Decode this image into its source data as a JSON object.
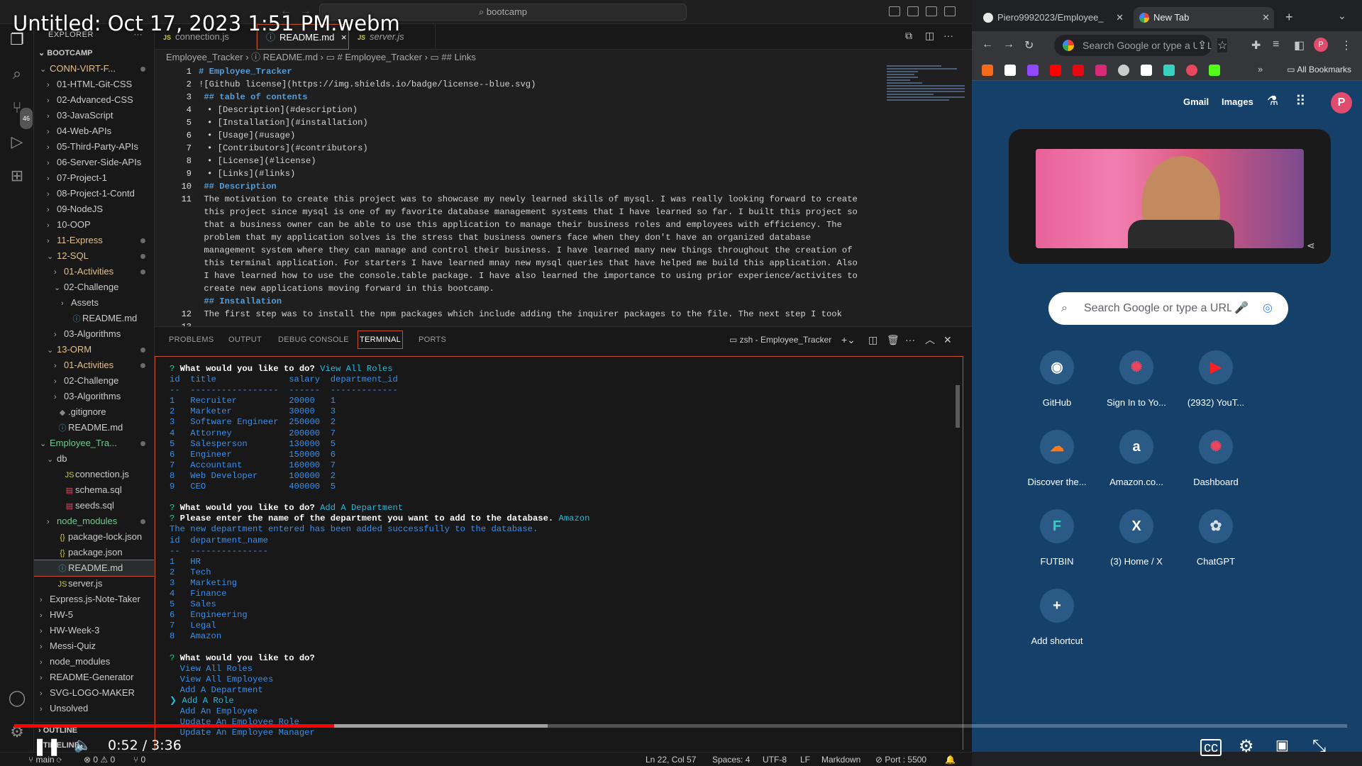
{
  "video": {
    "title": "Untitled: Oct 17, 2023 1:51 PM.webm",
    "time": "0:52 / 3:36",
    "progress": 0.24,
    "buffered": 0.4
  },
  "vscode": {
    "title_search": "bootcamp",
    "explorer_label": "EXPLORER",
    "root": "BOOTCAMP",
    "scm_badge": "46",
    "tree": [
      {
        "indent": 0,
        "chev": "⌄",
        "label": "CONN-VIRT-F...",
        "cls": "git-yellow",
        "dot": true
      },
      {
        "indent": 1,
        "chev": "›",
        "label": "01-HTML-Git-CSS"
      },
      {
        "indent": 1,
        "chev": "›",
        "label": "02-Advanced-CSS"
      },
      {
        "indent": 1,
        "chev": "›",
        "label": "03-JavaScript"
      },
      {
        "indent": 1,
        "chev": "›",
        "label": "04-Web-APIs"
      },
      {
        "indent": 1,
        "chev": "›",
        "label": "05-Third-Party-APIs"
      },
      {
        "indent": 1,
        "chev": "›",
        "label": "06-Server-Side-APIs"
      },
      {
        "indent": 1,
        "chev": "›",
        "label": "07-Project-1"
      },
      {
        "indent": 1,
        "chev": "›",
        "label": "08-Project-1-Contd"
      },
      {
        "indent": 1,
        "chev": "›",
        "label": "09-NodeJS"
      },
      {
        "indent": 1,
        "chev": "›",
        "label": "10-OOP"
      },
      {
        "indent": 1,
        "chev": "›",
        "label": "11-Express",
        "cls": "git-yellow",
        "dot": true
      },
      {
        "indent": 1,
        "chev": "⌄",
        "label": "12-SQL",
        "cls": "git-yellow",
        "dot": true
      },
      {
        "indent": 2,
        "chev": "›",
        "label": "01-Activities",
        "cls": "git-yellow",
        "dot": true
      },
      {
        "indent": 2,
        "chev": "⌄",
        "label": "02-Challenge"
      },
      {
        "indent": 3,
        "chev": "›",
        "label": "Assets"
      },
      {
        "indent": 3,
        "chev": "",
        "icon": "ⓘ",
        "label": "README.md"
      },
      {
        "indent": 2,
        "chev": "›",
        "label": "03-Algorithms"
      },
      {
        "indent": 1,
        "chev": "⌄",
        "label": "13-ORM",
        "cls": "git-yellow",
        "dot": true
      },
      {
        "indent": 2,
        "chev": "›",
        "label": "01-Activities",
        "cls": "git-yellow",
        "dot": true
      },
      {
        "indent": 2,
        "chev": "›",
        "label": "02-Challenge"
      },
      {
        "indent": 2,
        "chev": "›",
        "label": "03-Algorithms"
      },
      {
        "indent": 1,
        "chev": "",
        "icon": "◆",
        "label": ".gitignore"
      },
      {
        "indent": 1,
        "chev": "",
        "icon": "ⓘ",
        "label": "README.md"
      },
      {
        "indent": 0,
        "chev": "⌄",
        "label": "Employee_Tra...",
        "cls": "git-green",
        "dot": true
      },
      {
        "indent": 1,
        "chev": "⌄",
        "label": "db"
      },
      {
        "indent": 2,
        "chev": "",
        "icon": "JS",
        "label": "connection.js"
      },
      {
        "indent": 2,
        "chev": "",
        "icon": "▤",
        "label": "schema.sql"
      },
      {
        "indent": 2,
        "chev": "",
        "icon": "▤",
        "label": "seeds.sql"
      },
      {
        "indent": 1,
        "chev": "›",
        "label": "node_modules",
        "cls": "git-green",
        "dot": true
      },
      {
        "indent": 1,
        "chev": "",
        "icon": "{}",
        "label": "package-lock.json"
      },
      {
        "indent": 1,
        "chev": "",
        "icon": "{}",
        "label": "package.json"
      },
      {
        "indent": 1,
        "chev": "",
        "icon": "ⓘ",
        "label": "README.md",
        "sel": true
      },
      {
        "indent": 1,
        "chev": "",
        "icon": "JS",
        "label": "server.js"
      },
      {
        "indent": 0,
        "chev": "›",
        "label": "Express.js-Note-Taker"
      },
      {
        "indent": 0,
        "chev": "›",
        "label": "HW-5"
      },
      {
        "indent": 0,
        "chev": "›",
        "label": "HW-Week-3"
      },
      {
        "indent": 0,
        "chev": "›",
        "label": "Messi-Quiz"
      },
      {
        "indent": 0,
        "chev": "›",
        "label": "node_modules"
      },
      {
        "indent": 0,
        "chev": "›",
        "label": "README-Generator"
      },
      {
        "indent": 0,
        "chev": "›",
        "label": "SVG-LOGO-MAKER"
      },
      {
        "indent": 0,
        "chev": "›",
        "label": "Unsolved"
      }
    ],
    "outline_label": "OUTLINE",
    "timeline_label": "TIMELINE",
    "tabs": {
      "connection": "connection.js",
      "readme": "README.md",
      "server": "server.js"
    },
    "breadcrumb": "Employee_Tracker  ›  ⓘ README.md  ›  ▭ # Employee_Tracker  ›  ▭ ## Links",
    "line_numbers": [
      "1",
      "2",
      "3",
      "4",
      "5",
      "6",
      "7",
      "8",
      "9",
      "10",
      "11",
      "",
      "",
      "",
      "",
      "",
      "",
      "",
      "",
      "12",
      "13"
    ],
    "code": [
      {
        "cls": "h",
        "text": "# Employee_Tracker"
      },
      {
        "cls": "",
        "text": "![Github license](https://img.shields.io/badge/license--blue.svg)"
      },
      {
        "cls": "h",
        "text": " ## table of contents"
      },
      {
        "cls": "list",
        "text": "• [Description](#description)"
      },
      {
        "cls": "list",
        "text": "• [Installation](#installation)"
      },
      {
        "cls": "list",
        "text": "• [Usage](#usage)"
      },
      {
        "cls": "list",
        "text": "• [Contributors](#contributors)"
      },
      {
        "cls": "list",
        "text": "• [License](#license)"
      },
      {
        "cls": "list",
        "text": "• [Links](#links)"
      },
      {
        "cls": "h",
        "text": " ## Description"
      },
      {
        "cls": "",
        "text": " The motivation to create this project was to showcase my newly learned skills of mysql. I was really looking forward to create"
      },
      {
        "cls": "",
        "text": " this project since mysql is one of my favorite database management systems that I have learned so far. I built this project so"
      },
      {
        "cls": "",
        "text": " that a business owner can be able to use this application to manage their business roles and employees with efficiency. The"
      },
      {
        "cls": "",
        "text": " problem that my application solves is the stress that business owners face when they don't have an organized database"
      },
      {
        "cls": "",
        "text": " management system where they can manage and control their business. I have learned many new things throughout the creation of"
      },
      {
        "cls": "",
        "text": " this terminal application. For starters I have learned mnay new mysql queries that have helped me build this application. Also"
      },
      {
        "cls": "",
        "text": " I have learned how to use the console.table package. I have also learned the importance to using prior experience/activites to"
      },
      {
        "cls": "",
        "text": " create new applications moving forward in this bootcamp."
      },
      {
        "cls": "h",
        "text": " ## Installation"
      },
      {
        "cls": "",
        "text": " The first step was to install the npm packages which include adding the inquirer packages to the file. The next step I took"
      }
    ],
    "panel_tabs": {
      "problems": "PROBLEMS",
      "output": "OUTPUT",
      "debug": "DEBUG CONSOLE",
      "terminal": "TERMINAL",
      "ports": "PORTS"
    },
    "terminal_name": "zsh - Employee_Tracker",
    "terminal": [
      {
        "type": "q",
        "prompt": "? ",
        "question": "What would you like to do?",
        "answer": " View All Roles"
      },
      {
        "type": "t",
        "text": "id  title              salary  department_id"
      },
      {
        "type": "t",
        "text": "--  -----------------  ------  -------------"
      },
      {
        "type": "t",
        "text": "1   Recruiter          20000   1"
      },
      {
        "type": "t",
        "text": "2   Marketer           30000   3"
      },
      {
        "type": "t",
        "text": "3   Software Engineer  250000  2"
      },
      {
        "type": "t",
        "text": "4   Attorney           200000  7"
      },
      {
        "type": "t",
        "text": "5   Salesperson        130000  5"
      },
      {
        "type": "t",
        "text": "6   Engineer           150000  6"
      },
      {
        "type": "t",
        "text": "7   Accountant         160000  7"
      },
      {
        "type": "t",
        "text": "8   Web Developer      100000  2"
      },
      {
        "type": "t",
        "text": "9   CEO                400000  5"
      },
      {
        "type": "t",
        "text": ""
      },
      {
        "type": "q",
        "prompt": "? ",
        "question": "What would you like to do?",
        "answer": " Add A Department"
      },
      {
        "type": "q",
        "prompt": "? ",
        "question": "Please enter the name of the department you want to add to the database.",
        "answer": " Amazon"
      },
      {
        "type": "t",
        "text": "The new department entered has been added successfully to the database."
      },
      {
        "type": "t",
        "text": "id  department_name"
      },
      {
        "type": "t",
        "text": "--  ---------------"
      },
      {
        "type": "t",
        "text": "1   HR"
      },
      {
        "type": "t",
        "text": "2   Tech"
      },
      {
        "type": "t",
        "text": "3   Marketing"
      },
      {
        "type": "t",
        "text": "4   Finance"
      },
      {
        "type": "t",
        "text": "5   Sales"
      },
      {
        "type": "t",
        "text": "6   Engineering"
      },
      {
        "type": "t",
        "text": "7   Legal"
      },
      {
        "type": "t",
        "text": "8   Amazon"
      },
      {
        "type": "t",
        "text": ""
      },
      {
        "type": "q",
        "prompt": "? ",
        "question": "What would you like to do?",
        "answer": ""
      },
      {
        "type": "t",
        "text": "  View All Roles"
      },
      {
        "type": "t",
        "text": "  View All Employees"
      },
      {
        "type": "t",
        "text": "  Add A Department"
      },
      {
        "type": "sel",
        "text": "❯ Add A Role"
      },
      {
        "type": "t",
        "text": "  Add An Employee"
      },
      {
        "type": "t",
        "text": "  Update An Employee Role"
      },
      {
        "type": "t",
        "text": "  Update An Employee Manager"
      }
    ],
    "status": {
      "branch": "main",
      "sync": "⟳",
      "problems": "⊗ 0 ⚠ 0",
      "ports": "⑂ 0",
      "position": "Ln 22, Col 57",
      "spaces": "Spaces: 4",
      "encoding": "UTF-8",
      "eol": "LF",
      "language": "Markdown",
      "port": "Port : 5500"
    }
  },
  "chrome": {
    "tabs": {
      "tab1": "Piero9992023/Employee_",
      "tab2": "New Tab"
    },
    "omnibox_placeholder": "Search Google or type a URL",
    "all_bookmarks": "All Bookmarks",
    "links": {
      "gmail": "Gmail",
      "images": "Images"
    },
    "profile_initial": "P",
    "search_placeholder": "Search Google or type a URL",
    "shortcuts": [
      {
        "label": "GitHub",
        "glyph": "◉",
        "color": "#ffffff"
      },
      {
        "label": "Sign In to Yo...",
        "glyph": "✺",
        "color": "#e8475f"
      },
      {
        "label": "(2932) YouT...",
        "glyph": "▶",
        "color": "#ff2020"
      },
      {
        "label": "Discover the...",
        "glyph": "☁",
        "color": "#ff7a1a"
      },
      {
        "label": "Amazon.co...",
        "glyph": "a",
        "color": "#ffffff"
      },
      {
        "label": "Dashboard",
        "glyph": "✺",
        "color": "#e8475f"
      },
      {
        "label": "FUTBIN",
        "glyph": "F",
        "color": "#3ad0c0"
      },
      {
        "label": "(3) Home / X",
        "glyph": "X",
        "color": "#ffffff"
      },
      {
        "label": "ChatGPT",
        "glyph": "✿",
        "color": "#d0e0e0"
      },
      {
        "label": "Add shortcut",
        "glyph": "+",
        "color": "#ffffff"
      }
    ]
  }
}
